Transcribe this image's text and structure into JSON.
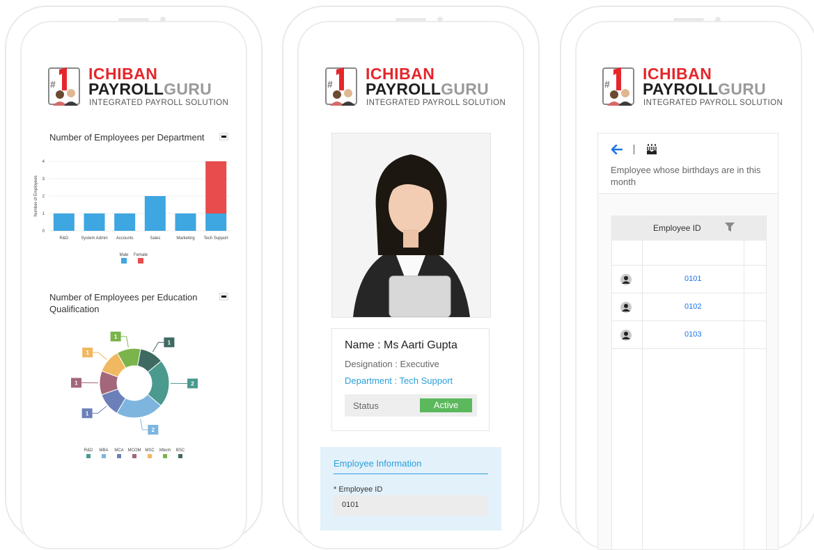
{
  "brand": {
    "line1": "ICHIBAN",
    "line2_a": "PAYROLL",
    "line2_b": "GURU",
    "tagline": "INTEGRATED PAYROLL SOLUTION",
    "badge": "#1"
  },
  "dashboard": {
    "dept_chart_title": "Number of Employees per Department",
    "edu_chart_title": "Number of Employees per Education Qualification"
  },
  "chart_data": [
    {
      "type": "bar",
      "stacked": true,
      "title": "Number of Employees per Department",
      "ylabel": "Number of Employees",
      "categories": [
        "R&D",
        "System Admin",
        "Accounts",
        "Sales",
        "Marketing",
        "Tech Support"
      ],
      "series": [
        {
          "name": "Male",
          "color": "#3ea6e0",
          "values": [
            1,
            1,
            1,
            2,
            1,
            1
          ]
        },
        {
          "name": "Female",
          "color": "#e84c4c",
          "values": [
            0,
            0,
            0,
            0,
            0,
            3
          ]
        }
      ],
      "yticks": [
        0,
        1,
        2,
        3,
        4
      ],
      "ylim": [
        0,
        4
      ],
      "legend": "bottom"
    },
    {
      "type": "pie",
      "donut": true,
      "title": "Number of Employees per Education Qualification",
      "slices": [
        {
          "name": "R&D",
          "value": 2,
          "color": "#4a9a8e"
        },
        {
          "name": "MBA",
          "value": 2,
          "color": "#7db5de"
        },
        {
          "name": "MCA",
          "value": 1,
          "color": "#6b80b8"
        },
        {
          "name": "MCOM",
          "value": 1,
          "color": "#a3667a"
        },
        {
          "name": "MSC",
          "value": 1,
          "color": "#f0b860"
        },
        {
          "name": "Mtech",
          "value": 1,
          "color": "#7ab44a"
        },
        {
          "name": "BSC",
          "value": 1,
          "color": "#3e6a62"
        }
      ],
      "legend": "bottom"
    }
  ],
  "profile": {
    "name": "Name : Ms Aarti Gupta",
    "designation": "Designation : Executive",
    "department": "Department : Tech Support",
    "status_label": "Status",
    "status_value": "Active",
    "info_heading": "Employee Information",
    "employee_id_label": "* Employee ID",
    "employee_id_value": "0101"
  },
  "birthdays": {
    "subtitle": "Employee whose birthdays are in this month",
    "column_header": "Employee ID",
    "rows": [
      "0101",
      "0102",
      "0103"
    ]
  },
  "icons": {
    "back": "arrow-left-icon",
    "cake": "birthday-cake-icon",
    "filter": "filter-icon",
    "user": "user-avatar-icon",
    "menu": "chart-menu-icon"
  },
  "colors": {
    "brand_red": "#e5262b",
    "link_blue": "#2a9fd8",
    "active_green": "#5cb85c"
  }
}
